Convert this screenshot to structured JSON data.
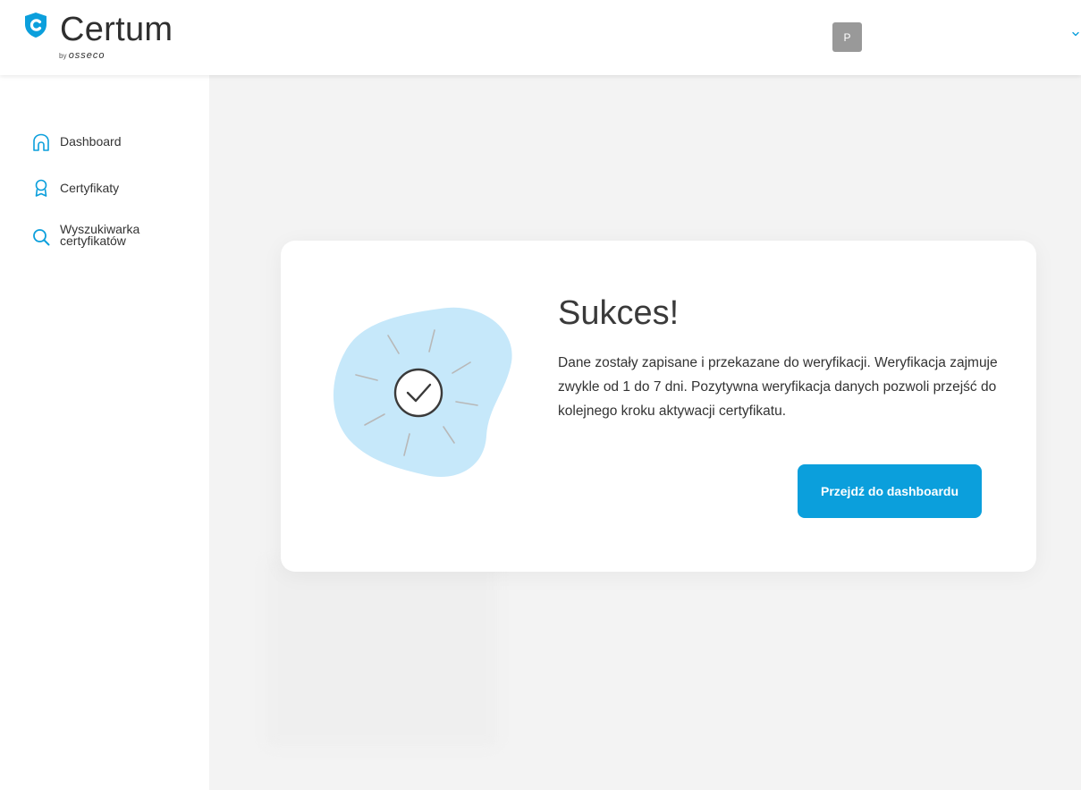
{
  "brand": {
    "name": "Certum",
    "by_label": "by",
    "parent_name": "osseco",
    "logo_icon": "shield-c-icon",
    "accent_color": "#0b9fdc",
    "blob_color": "#c6e8fa"
  },
  "header": {
    "avatar_initial": "P",
    "user_menu_icon": "chevron-down-icon"
  },
  "sidebar": {
    "items": [
      {
        "label": "Dashboard",
        "icon": "home-icon"
      },
      {
        "label": "Certyfikaty",
        "icon": "award-icon"
      },
      {
        "label": "Wyszukiwarka certyfikatów",
        "icon": "search-icon"
      }
    ]
  },
  "success": {
    "title": "Sukces!",
    "description": "Dane zostały zapisane i przekazane do weryfikacji. Weryfikacja zajmuje zwykle od 1 do 7 dni. Pozytywna weryfikacja danych pozwoli przejść do kolejnego kroku aktywacji certyfikatu.",
    "button_label": "Przejdź do dashboardu",
    "illustration_icon": "check-circle-icon"
  }
}
